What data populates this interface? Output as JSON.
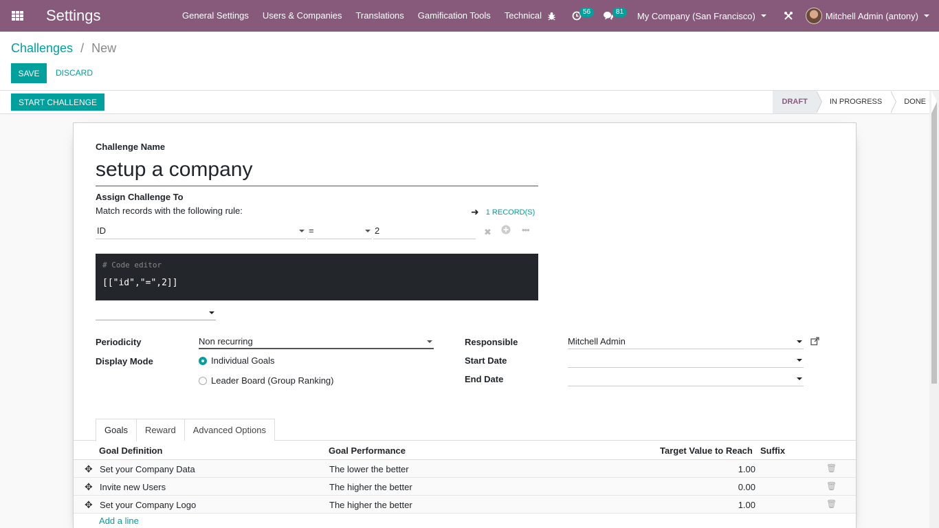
{
  "navbar": {
    "app_title": "Settings",
    "menu": [
      "General Settings",
      "Users & Companies",
      "Translations",
      "Gamification Tools",
      "Technical"
    ],
    "activity_count": "56",
    "messages_count": "81",
    "company": "My Company (San Francisco)",
    "user": "Mitchell Admin (antony)"
  },
  "breadcrumb": {
    "parent": "Challenges",
    "separator": "/",
    "current": "New"
  },
  "buttons": {
    "save": "SAVE",
    "discard": "DISCARD",
    "start_challenge": "START CHALLENGE"
  },
  "status_steps": [
    "DRAFT",
    "IN PROGRESS",
    "DONE"
  ],
  "form": {
    "challenge_name_label": "Challenge Name",
    "challenge_name": "setup a company",
    "assign_label": "Assign Challenge To",
    "match_rule_text": "Match records with the following rule:",
    "records_link": "1 RECORD(S)",
    "domain": {
      "field": "ID",
      "operator": "=",
      "value": "2"
    },
    "code_comment": "# Code editor",
    "code_value": "[[\"id\",\"=\",2]]",
    "periodicity_label": "Periodicity",
    "periodicity_value": "Non recurring",
    "display_mode_label": "Display Mode",
    "display_options": [
      "Individual Goals",
      "Leader Board (Group Ranking)"
    ],
    "responsible_label": "Responsible",
    "responsible_value": "Mitchell Admin",
    "start_date_label": "Start Date",
    "end_date_label": "End Date"
  },
  "tabs": [
    "Goals",
    "Reward",
    "Advanced Options"
  ],
  "goals_table": {
    "headers": [
      "Goal Definition",
      "Goal Performance",
      "Target Value to Reach",
      "Suffix"
    ],
    "rows": [
      [
        "Set your Company Data",
        "The lower the better",
        "1.00"
      ],
      [
        "Invite new Users",
        "The higher the better",
        "0.00"
      ],
      [
        "Set your Company Logo",
        "The higher the better",
        "1.00"
      ]
    ],
    "add_line": "Add a line"
  },
  "colors": {
    "navbar": "#875a7b",
    "primary": "#00a09d"
  }
}
